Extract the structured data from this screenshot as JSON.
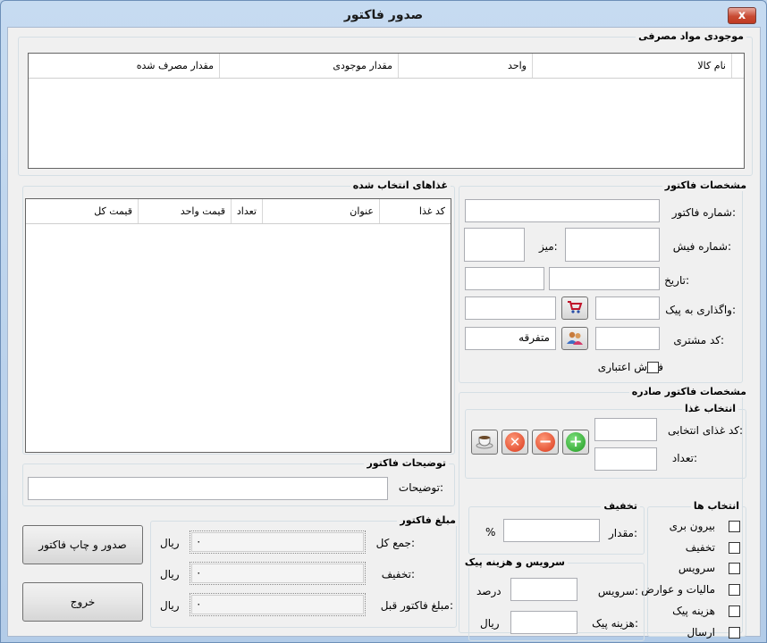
{
  "window": {
    "title": "صدور فاکتور",
    "close_glyph": "x"
  },
  "inventory": {
    "legend": "موجودی مواد مصرفی",
    "columns": [
      "نام کالا",
      "واحد",
      "مقدار موجودی",
      "مقدار مصرف شده"
    ]
  },
  "foods": {
    "legend": "غذاهای انتخاب شده",
    "columns": [
      "کد غذا",
      "عنوان",
      "تعداد",
      "قیمت واحد",
      "قیمت کل"
    ]
  },
  "notes": {
    "legend": "توضیحات فاکتور",
    "label": "توضیحات:",
    "value": ""
  },
  "invoice": {
    "legend": "مشخصات فاکتور",
    "number_label": "شماره فاکتور:",
    "receipt_label": "شماره فیش:",
    "table_label": "میز:",
    "date_label": "تاریخ:",
    "courier_label": "واگذاری به پیک:",
    "customer_label": "کد مشتری:",
    "customer_value": "متفرقه",
    "credit_label": "فروش اعتباری",
    "credit_checked": false
  },
  "issued": {
    "legend": "مشخصات فاکتور صادره",
    "food_select": {
      "legend": "انتخاب غذا",
      "code_label": "کد غذای انتخابی:",
      "qty_label": "تعداد:"
    },
    "discount": {
      "legend": "تخفیف",
      "amount_label": "مقدار:",
      "percent": "%"
    },
    "service": {
      "legend": "سرویس و هزینه پیک",
      "service_label": "سرویس:",
      "service_unit": "درصد",
      "courier_label": "هزینه پیک:",
      "courier_unit": "ریال"
    },
    "options": {
      "legend": "انتخاب ها",
      "items": [
        {
          "label": "بیرون بری",
          "checked": false
        },
        {
          "label": "تخفیف",
          "checked": false
        },
        {
          "label": "سرویس",
          "checked": false
        },
        {
          "label": "مالیات و عوارض",
          "checked": false
        },
        {
          "label": "هزینه پیک",
          "checked": false
        },
        {
          "label": "ارسال",
          "checked": false
        }
      ]
    }
  },
  "amount": {
    "legend": "مبلغ فاکتور",
    "total_label": "جمع کل:",
    "total_value": "۰",
    "discount_label": "تخفیف:",
    "discount_value": "۰",
    "prev_label": "مبلغ فاکتور قبل:",
    "prev_value": "۰",
    "unit": "ریال"
  },
  "actions": {
    "issue_print": "صدور و چاپ فاکتور",
    "exit": "خروج"
  }
}
